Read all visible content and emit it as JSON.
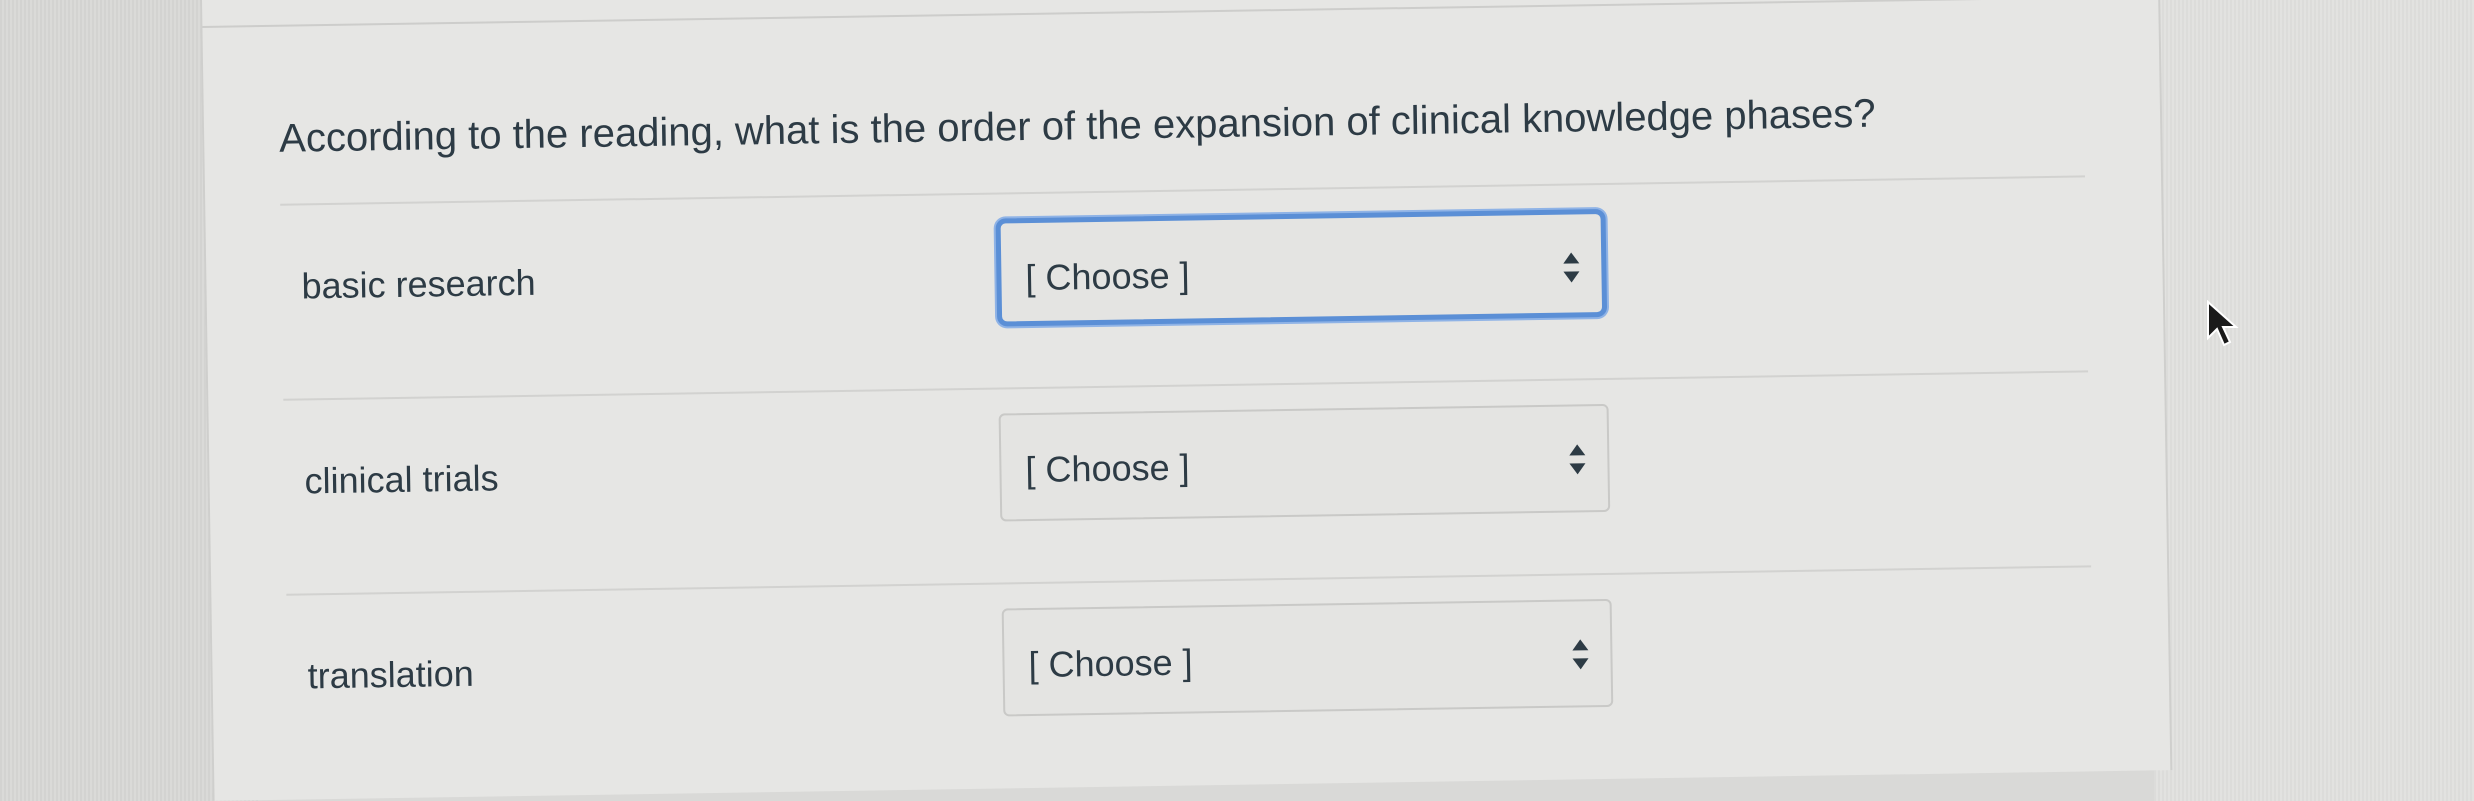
{
  "question": {
    "text": "According to the reading, what is the order of the expansion of clinical knowledge phases?"
  },
  "answers": [
    {
      "label": "basic research",
      "selected": "[ Choose ]",
      "focused": true
    },
    {
      "label": "clinical trials",
      "selected": "[ Choose ]",
      "focused": false
    },
    {
      "label": "translation",
      "selected": "[ Choose ]",
      "focused": false
    }
  ],
  "icons": {
    "select_arrows": "up-down-arrows-icon",
    "cursor": "mouse-pointer-icon"
  },
  "colors": {
    "focus_border": "#5b8fd6",
    "text": "#2d3b45",
    "background": "#e6e6e4"
  }
}
